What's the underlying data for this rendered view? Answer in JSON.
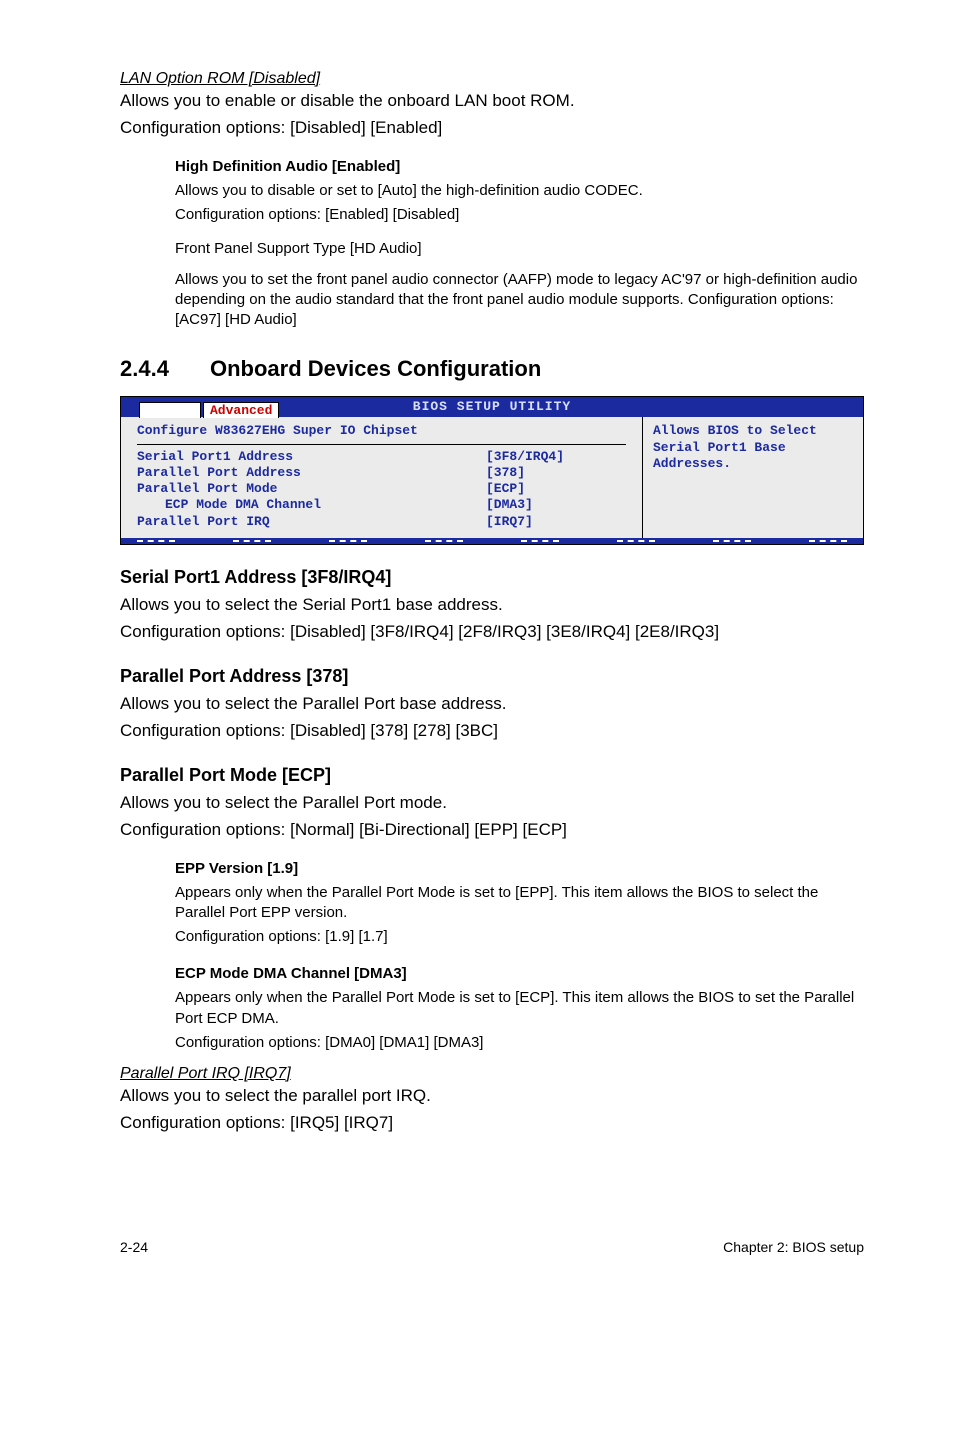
{
  "lanOption": {
    "title": "LAN Option ROM [Disabled]",
    "line1": "Allows you to enable or disable the onboard LAN boot ROM.",
    "line2": "Configuration options: [Disabled] [Enabled]"
  },
  "hdAudio": {
    "title": "High Definition Audio [Enabled]",
    "line1": "Allows you to disable or set to [Auto] the high-definition audio CODEC.",
    "line2": "Configuration options: [Enabled] [Disabled]",
    "fpTitle": "Front Panel Support Type [HD Audio]",
    "fpBody": "Allows you to set the front panel audio connector (AAFP) mode to legacy AC'97 or high-definition audio depending on the audio standard that the front panel audio module supports. Configuration options: [AC97] [HD Audio]"
  },
  "section": {
    "num": "2.4.4",
    "title": "Onboard Devices Configuration"
  },
  "bios": {
    "headerTitle": "BIOS SETUP UTILITY",
    "tab": "Advanced",
    "leftTitle": "Configure W83627EHG Super IO Chipset",
    "rows": [
      {
        "label": "Serial Port1 Address",
        "value": "[3F8/IRQ4]",
        "indent": false
      },
      {
        "label": "Parallel Port Address",
        "value": "[378]",
        "indent": false
      },
      {
        "label": "Parallel Port Mode",
        "value": "[ECP]",
        "indent": false
      },
      {
        "label": "ECP Mode DMA Channel",
        "value": "[DMA3]",
        "indent": true
      },
      {
        "label": "Parallel Port IRQ",
        "value": "[IRQ7]",
        "indent": false
      }
    ],
    "rightText": "Allows BIOS to Select Serial Port1 Base Addresses."
  },
  "serialPort": {
    "title": "Serial Port1 Address [3F8/IRQ4]",
    "line1": "Allows you to select the Serial Port1 base address.",
    "line2": "Configuration options: [Disabled] [3F8/IRQ4] [2F8/IRQ3] [3E8/IRQ4] [2E8/IRQ3]"
  },
  "parallelAddr": {
    "title": "Parallel Port Address [378]",
    "line1": "Allows you to select the Parallel Port base address.",
    "line2": "Configuration options: [Disabled] [378] [278] [3BC]"
  },
  "parallelMode": {
    "title": "Parallel Port Mode [ECP]",
    "line1": "Allows you to select the Parallel Port mode.",
    "line2": "Configuration options: [Normal] [Bi-Directional] [EPP] [ECP]"
  },
  "epp": {
    "title": "EPP Version [1.9]",
    "line1": "Appears only when the Parallel Port Mode is set to [EPP]. This item allows the BIOS to select the Parallel Port EPP version.",
    "line2": "Configuration options: [1.9] [1.7]"
  },
  "ecpDma": {
    "title": "ECP Mode DMA Channel [DMA3]",
    "line1": "Appears only when the Parallel Port Mode is set to [ECP]. This item allows the BIOS to set the Parallel Port ECP DMA.",
    "line2": "Configuration options: [DMA0] [DMA1] [DMA3]"
  },
  "parallelIrq": {
    "title": "Parallel Port IRQ [IRQ7]",
    "line1": "Allows you to select the parallel port IRQ.",
    "line2": "Configuration options: [IRQ5] [IRQ7]"
  },
  "footer": {
    "left": "2-24",
    "right": "Chapter 2: BIOS setup"
  }
}
